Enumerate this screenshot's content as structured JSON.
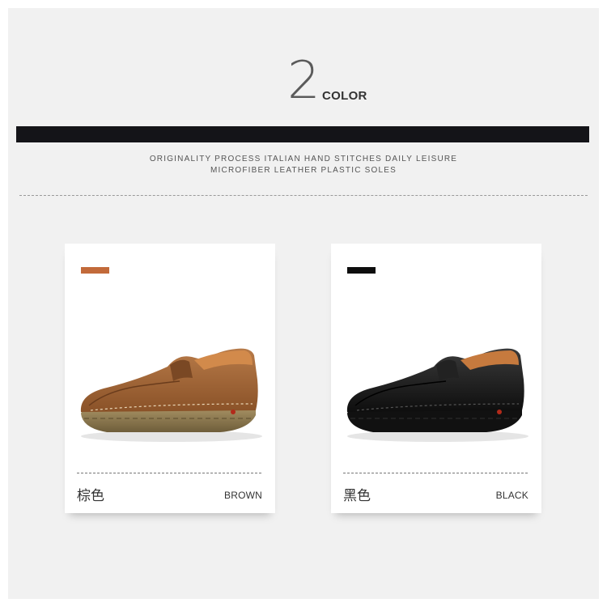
{
  "header": {
    "number": "2",
    "word": "COLOR",
    "subtitle_line1": "ORIGINALITY PROCESS ITALIAN HAND STITCHES DAILY LEISURE",
    "subtitle_line2": "MICROFIBER LEATHER PLASTIC SOLES"
  },
  "colors": [
    {
      "name_cn": "棕色",
      "name_en": "BROWN",
      "swatch": "#c26a3a"
    },
    {
      "name_cn": "黑色",
      "name_en": "BLACK",
      "swatch": "#0d0d0d"
    }
  ]
}
